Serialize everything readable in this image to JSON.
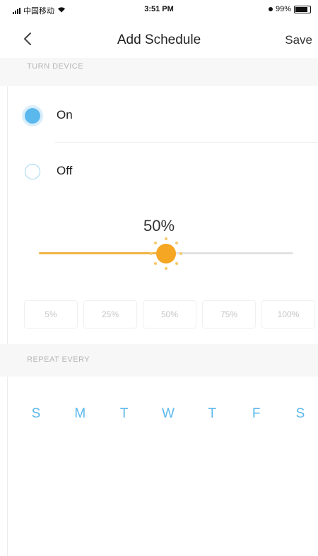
{
  "status_bar": {
    "carrier": "中国移动",
    "time": "3:51 PM",
    "battery": "99%"
  },
  "nav": {
    "title": "Add Schedule",
    "save_label": "Save"
  },
  "turn_device": {
    "header": "TURN DEVICE",
    "options": [
      {
        "label": "On",
        "selected": true
      },
      {
        "label": "Off",
        "selected": false
      }
    ]
  },
  "brightness": {
    "value_label": "50%",
    "value": 0.5,
    "presets": [
      "5%",
      "25%",
      "50%",
      "75%",
      "100%"
    ]
  },
  "repeat": {
    "header": "REPEAT EVERY",
    "days": [
      "S",
      "M",
      "T",
      "W",
      "T",
      "F",
      "S"
    ]
  },
  "colors": {
    "accent": "#5bb8ec",
    "slider": "#f5a623"
  }
}
